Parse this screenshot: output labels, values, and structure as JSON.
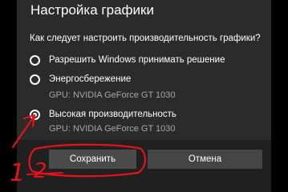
{
  "dialog": {
    "title": "Настройка графики",
    "question": "Как следует настроить производительность графики?",
    "options": [
      {
        "label": "Разрешить Windows принимать решение",
        "checked": false,
        "gpu": ""
      },
      {
        "label": "Энергосбережение",
        "checked": false,
        "gpu": "GPU: NVIDIA GeForce GT 1030"
      },
      {
        "label": "Высокая производительность",
        "checked": true,
        "gpu": "GPU: NVIDIA GeForce GT 1030"
      }
    ],
    "buttons": {
      "save": "Сохранить",
      "cancel": "Отмена"
    }
  },
  "annotations": {
    "step1": "1",
    "step2": "2",
    "color": "#e3121b"
  },
  "colors": {
    "dialog_bg": "#2b2b2b",
    "footer_bg": "#202020",
    "button_bg": "#454545",
    "secondary_text": "#a6a6a6"
  }
}
